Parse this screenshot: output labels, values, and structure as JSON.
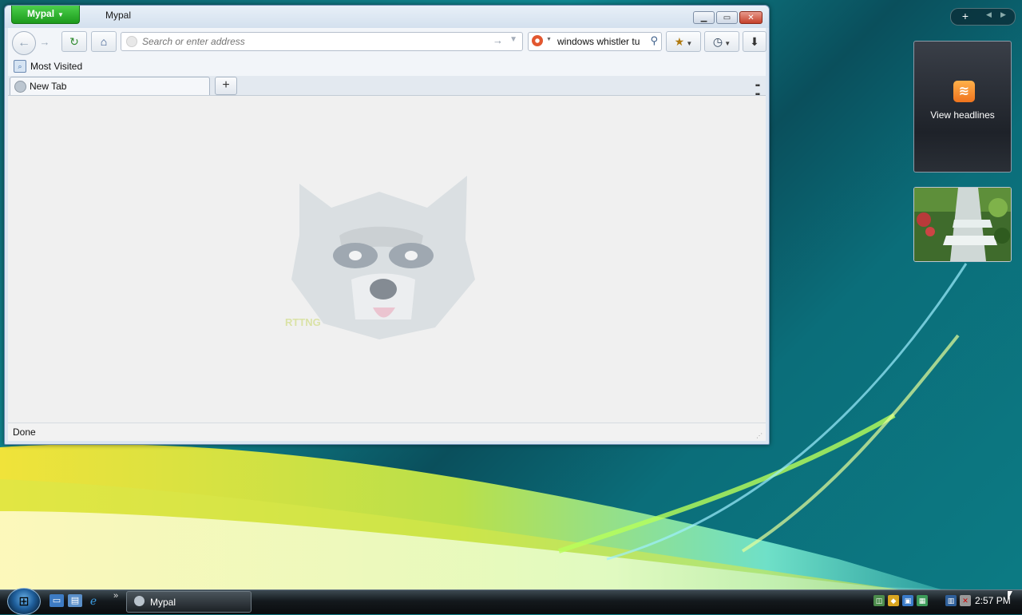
{
  "window": {
    "app_menu_label": "Mypal",
    "title": "Mypal",
    "controls": {
      "minimize": "minimize",
      "maximize": "maximize",
      "close": "close"
    }
  },
  "toolbar": {
    "url_placeholder": "Search or enter address",
    "url_value": "",
    "search_value": "windows whistler tu"
  },
  "bookmarks": {
    "items": [
      {
        "label": "Most Visited"
      }
    ]
  },
  "tabs": {
    "items": [
      {
        "label": "New Tab"
      }
    ],
    "new_tab_symbol": "+"
  },
  "status": {
    "text": "Done"
  },
  "gadgets": {
    "rss_label": "View headlines",
    "bar_plus": "+"
  },
  "taskbar": {
    "task_label": "Mypal",
    "clock": "2:57 PM"
  },
  "colors": {
    "app_button": "#1c9a1c",
    "close_button": "#c5402a",
    "rss_orange": "#f0741e"
  },
  "icons": {
    "back": "back-arrow-icon",
    "forward": "forward-arrow-icon",
    "reload": "reload-icon",
    "home": "home-icon",
    "bookmarks": "bookmark-star-icon",
    "history": "history-clock-icon",
    "downloads": "download-arrow-icon",
    "search_engine": "duckduckgo-icon",
    "search_go": "magnifier-icon"
  }
}
